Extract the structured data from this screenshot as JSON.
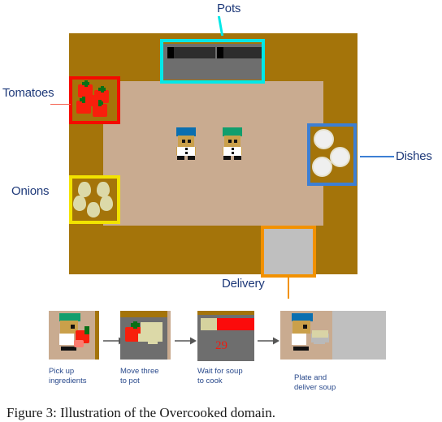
{
  "figure": {
    "caption": "Figure 3:  Illustration of the Overcooked domain."
  },
  "colors": {
    "counter": "#a4740a",
    "floor": "#c9ab90",
    "pot_highlight": "#00e8e8",
    "tomato_highlight": "#f40b00",
    "onion_highlight": "#f2e300",
    "dish_highlight": "#3d7fd4",
    "delivery_highlight": "#f29100",
    "label_text": "#1f3a7a",
    "timer_text": "#ee1b10",
    "tomato": "#f81f0c",
    "onion": "#dcd9a8",
    "dish": "#efefef",
    "delivery_pad": "#bfbfbf",
    "stove": "#6e6e6e",
    "chef_blue_hat": "#0a6fb0",
    "chef_green_hat": "#119e6d"
  },
  "annotations": [
    {
      "id": "pots",
      "label": "Pots",
      "leader": "vertical-down"
    },
    {
      "id": "tomatoes",
      "label": "Tomatoes",
      "leader": "horizontal-right"
    },
    {
      "id": "onions",
      "label": "Onions",
      "leader": "none"
    },
    {
      "id": "dishes",
      "label": "Dishes",
      "leader": "horizontal-left"
    },
    {
      "id": "delivery",
      "label": "Delivery",
      "leader": "vertical-up"
    }
  ],
  "kitchen": {
    "agents": [
      {
        "id": "agent-blue",
        "hat_color": "#0a6fb0"
      },
      {
        "id": "agent-green",
        "hat_color": "#119e6d"
      }
    ],
    "pot_count": 2,
    "tomato_count": 5,
    "onion_count": 5,
    "dish_count": 3,
    "delivery_count": 1
  },
  "filmstrip": {
    "steps": [
      {
        "id": "step-1",
        "caption": "Pick up\ningredients"
      },
      {
        "id": "step-2",
        "caption": "Move three\nto pot"
      },
      {
        "id": "step-3",
        "caption": "Wait for soup\nto cook",
        "timer": "29"
      },
      {
        "id": "step-4",
        "caption": "Plate and\ndeliver soup"
      }
    ],
    "arrow_glyph": "arrow-right"
  }
}
